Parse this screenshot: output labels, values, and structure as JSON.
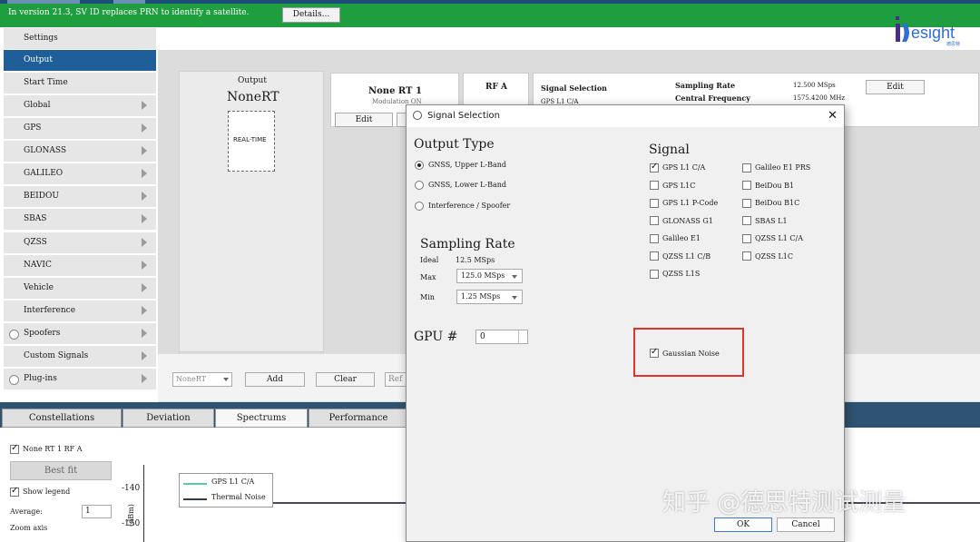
{
  "banner": {
    "text": "In version 21.3, SV ID replaces PRN to identify a satellite.",
    "details_label": "Details..."
  },
  "logo": {
    "text": "Desight",
    "subtext": "德思特"
  },
  "nav": {
    "items": [
      {
        "label": "Settings"
      },
      {
        "label": "Output"
      },
      {
        "label": "Start Time"
      },
      {
        "label": "Global"
      },
      {
        "label": "GPS"
      },
      {
        "label": "GLONASS"
      },
      {
        "label": "GALILEO"
      },
      {
        "label": "BEIDOU"
      },
      {
        "label": "SBAS"
      },
      {
        "label": "QZSS"
      },
      {
        "label": "NAVIC"
      },
      {
        "label": "Vehicle"
      },
      {
        "label": "Interference"
      },
      {
        "label": "Spoofers"
      },
      {
        "label": "Custom Signals"
      },
      {
        "label": "Plug-ins"
      }
    ]
  },
  "output_card": {
    "title": "Output",
    "name": "NoneRT",
    "box_label": "REAL-TIME"
  },
  "rt1_card": {
    "title": "None RT 1",
    "modulation": "Modulation ON",
    "edit_label": "Edit"
  },
  "rfa_card": {
    "title": "RF A"
  },
  "signal_card": {
    "selection_label": "Signal Selection",
    "selection_value": "GPS L1 C/A",
    "sampling_label": "Sampling Rate",
    "sampling_value": "12.500 MSps",
    "center_label": "Central Frequency",
    "center_value": "1575.4200 MHz",
    "edit_label": "Edit"
  },
  "bottom_toolbar": {
    "select_value": "NoneRT",
    "add_label": "Add",
    "clear_label": "Clear",
    "ref_label": "Ref"
  },
  "tabs": [
    {
      "label": "Constellations"
    },
    {
      "label": "Deviation"
    },
    {
      "label": "Spectrums"
    },
    {
      "label": "Performance"
    }
  ],
  "spectrum": {
    "series_check_label": "None RT 1 RF A",
    "bestfit_label": "Best fit",
    "show_legend_label": "Show legend",
    "average_label": "Average:",
    "average_value": "1",
    "zoom_label": "Zoom axis",
    "ytick_top": "-140",
    "ytick_bottom": "-150",
    "ylabel": "(dBm)",
    "legend": [
      {
        "name": "GPS L1 C/A",
        "color": "#5bc8a8"
      },
      {
        "name": "Thermal Noise",
        "color": "#333a55"
      }
    ]
  },
  "dialog": {
    "title": "Signal Selection",
    "output_type_heading": "Output Type",
    "output_types": [
      {
        "label": "GNSS, Upper L-Band",
        "selected": true
      },
      {
        "label": "GNSS, Lower L-Band",
        "selected": false
      },
      {
        "label": "Interference / Spoofer",
        "selected": false
      }
    ],
    "sampling_heading": "Sampling Rate",
    "ideal_label": "Ideal",
    "ideal_value": "12.5 MSps",
    "max_label": "Max",
    "max_value": "125.0 MSps",
    "min_label": "Min",
    "min_value": "1.25 MSps",
    "gpu_label": "GPU #",
    "gpu_value": "0",
    "signal_heading": "Signal",
    "signals_left": [
      {
        "label": "GPS L1 C/A",
        "checked": true
      },
      {
        "label": "GPS L1C",
        "checked": false
      },
      {
        "label": "GPS L1 P-Code",
        "checked": false
      },
      {
        "label": "GLONASS G1",
        "checked": false
      },
      {
        "label": "Galileo E1",
        "checked": false
      },
      {
        "label": "QZSS L1 C/B",
        "checked": false
      },
      {
        "label": "QZSS L1S",
        "checked": false
      }
    ],
    "signals_right": [
      {
        "label": "Galileo E1 PRS",
        "checked": false
      },
      {
        "label": "BeiDou B1",
        "checked": false
      },
      {
        "label": "BeiDou B1C",
        "checked": false
      },
      {
        "label": "SBAS L1",
        "checked": false
      },
      {
        "label": "QZSS L1 C/A",
        "checked": false
      },
      {
        "label": "QZSS L1C",
        "checked": false
      }
    ],
    "gaussian_label": "Gaussian Noise",
    "gaussian_checked": true,
    "ok_label": "OK",
    "cancel_label": "Cancel"
  },
  "watermark": "知乎 @德思特测试测量",
  "colors": {
    "banner": "#1f9e3f",
    "nav_active": "#1f5f99",
    "highlight": "#e0342a",
    "tabbar": "#2f5373"
  }
}
